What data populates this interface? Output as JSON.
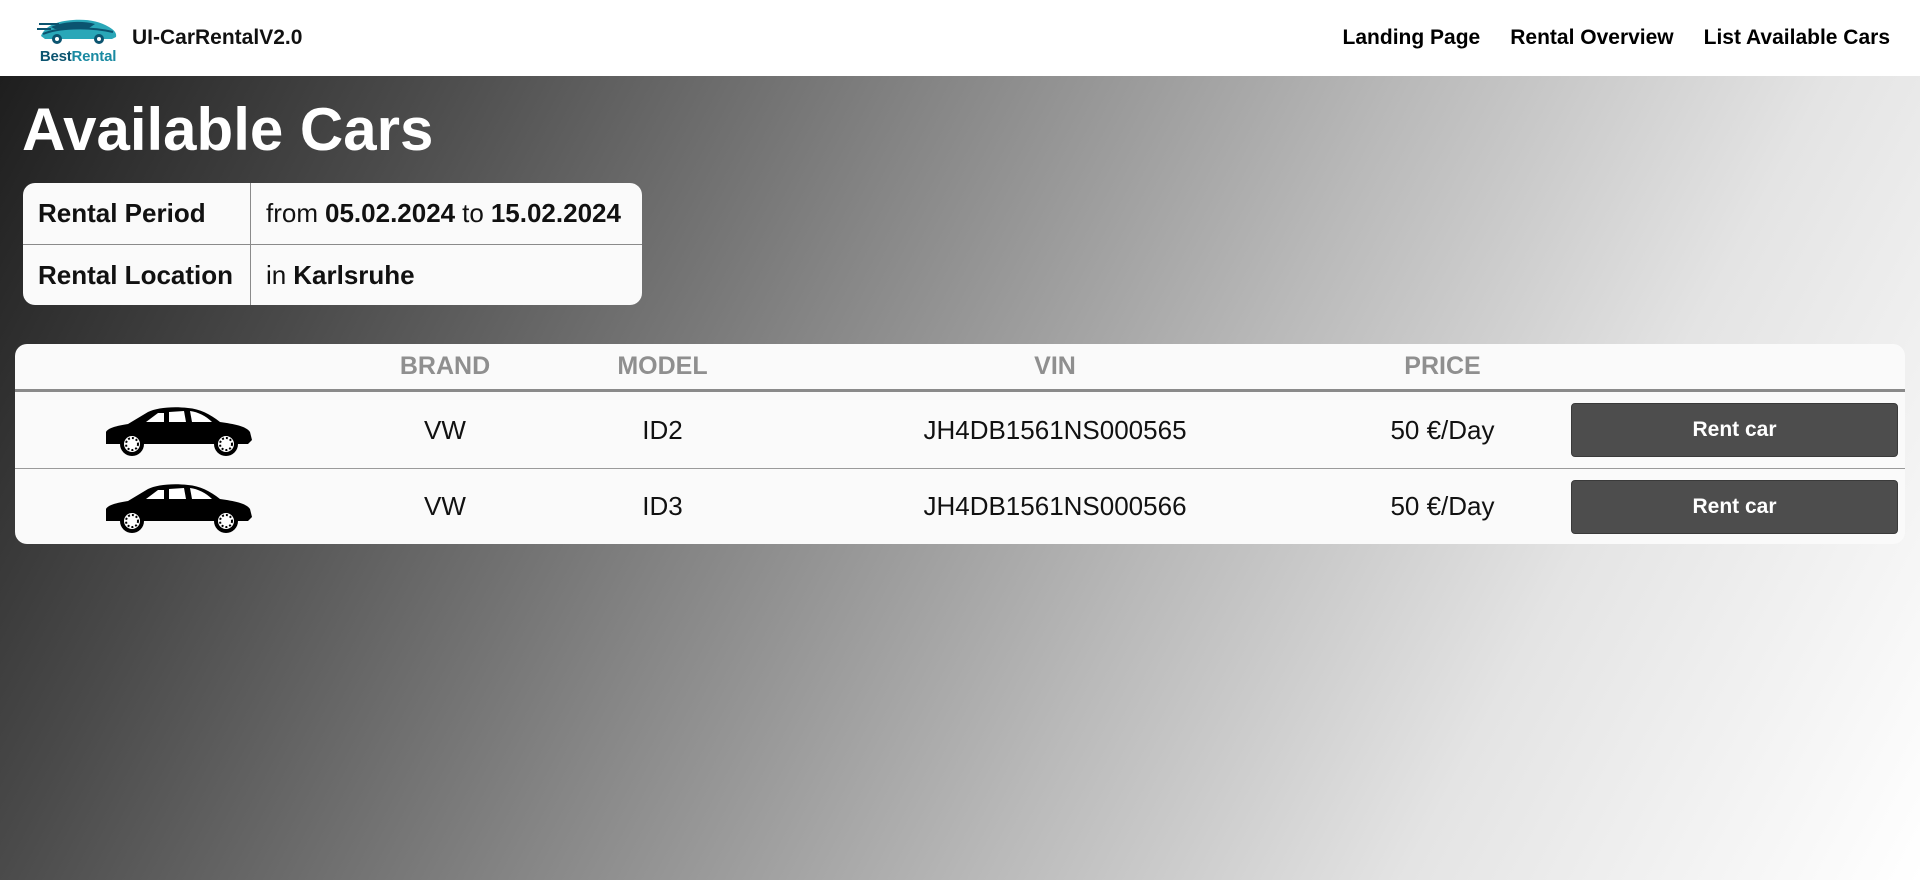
{
  "header": {
    "logo": {
      "icon": "car-logo-icon",
      "text_part1": "Best",
      "text_part2": "Rental",
      "colors": {
        "dark": "#0b5470",
        "accent": "#1a8aa2"
      }
    },
    "app_title": "UI-CarRentalV2.0",
    "nav": [
      {
        "label": "Landing Page"
      },
      {
        "label": "Rental Overview"
      },
      {
        "label": "List Available Cars"
      }
    ]
  },
  "page": {
    "title": "Available Cars"
  },
  "rental_info": {
    "period_label": "Rental Period",
    "period_from_word": "from",
    "period_from": "05.02.2024",
    "period_to_word": "to",
    "period_to": "15.02.2024",
    "location_label": "Rental Location",
    "location_prefix": "in",
    "location": "Karlsruhe"
  },
  "cars_table": {
    "columns": [
      "",
      "BRAND",
      "MODEL",
      "VIN",
      "PRICE",
      ""
    ],
    "rows": [
      {
        "icon": "sedan-car-icon",
        "brand": "VW",
        "model": "ID2",
        "vin": "JH4DB1561NS000565",
        "price": "50 €/Day",
        "action": "Rent car"
      },
      {
        "icon": "sedan-car-icon",
        "brand": "VW",
        "model": "ID3",
        "vin": "JH4DB1561NS000566",
        "price": "50 €/Day",
        "action": "Rent car"
      }
    ]
  },
  "colors": {
    "button_bg": "#4d4d4d",
    "header_text_muted": "#8f8f8f",
    "card_bg": "#fafafa"
  }
}
